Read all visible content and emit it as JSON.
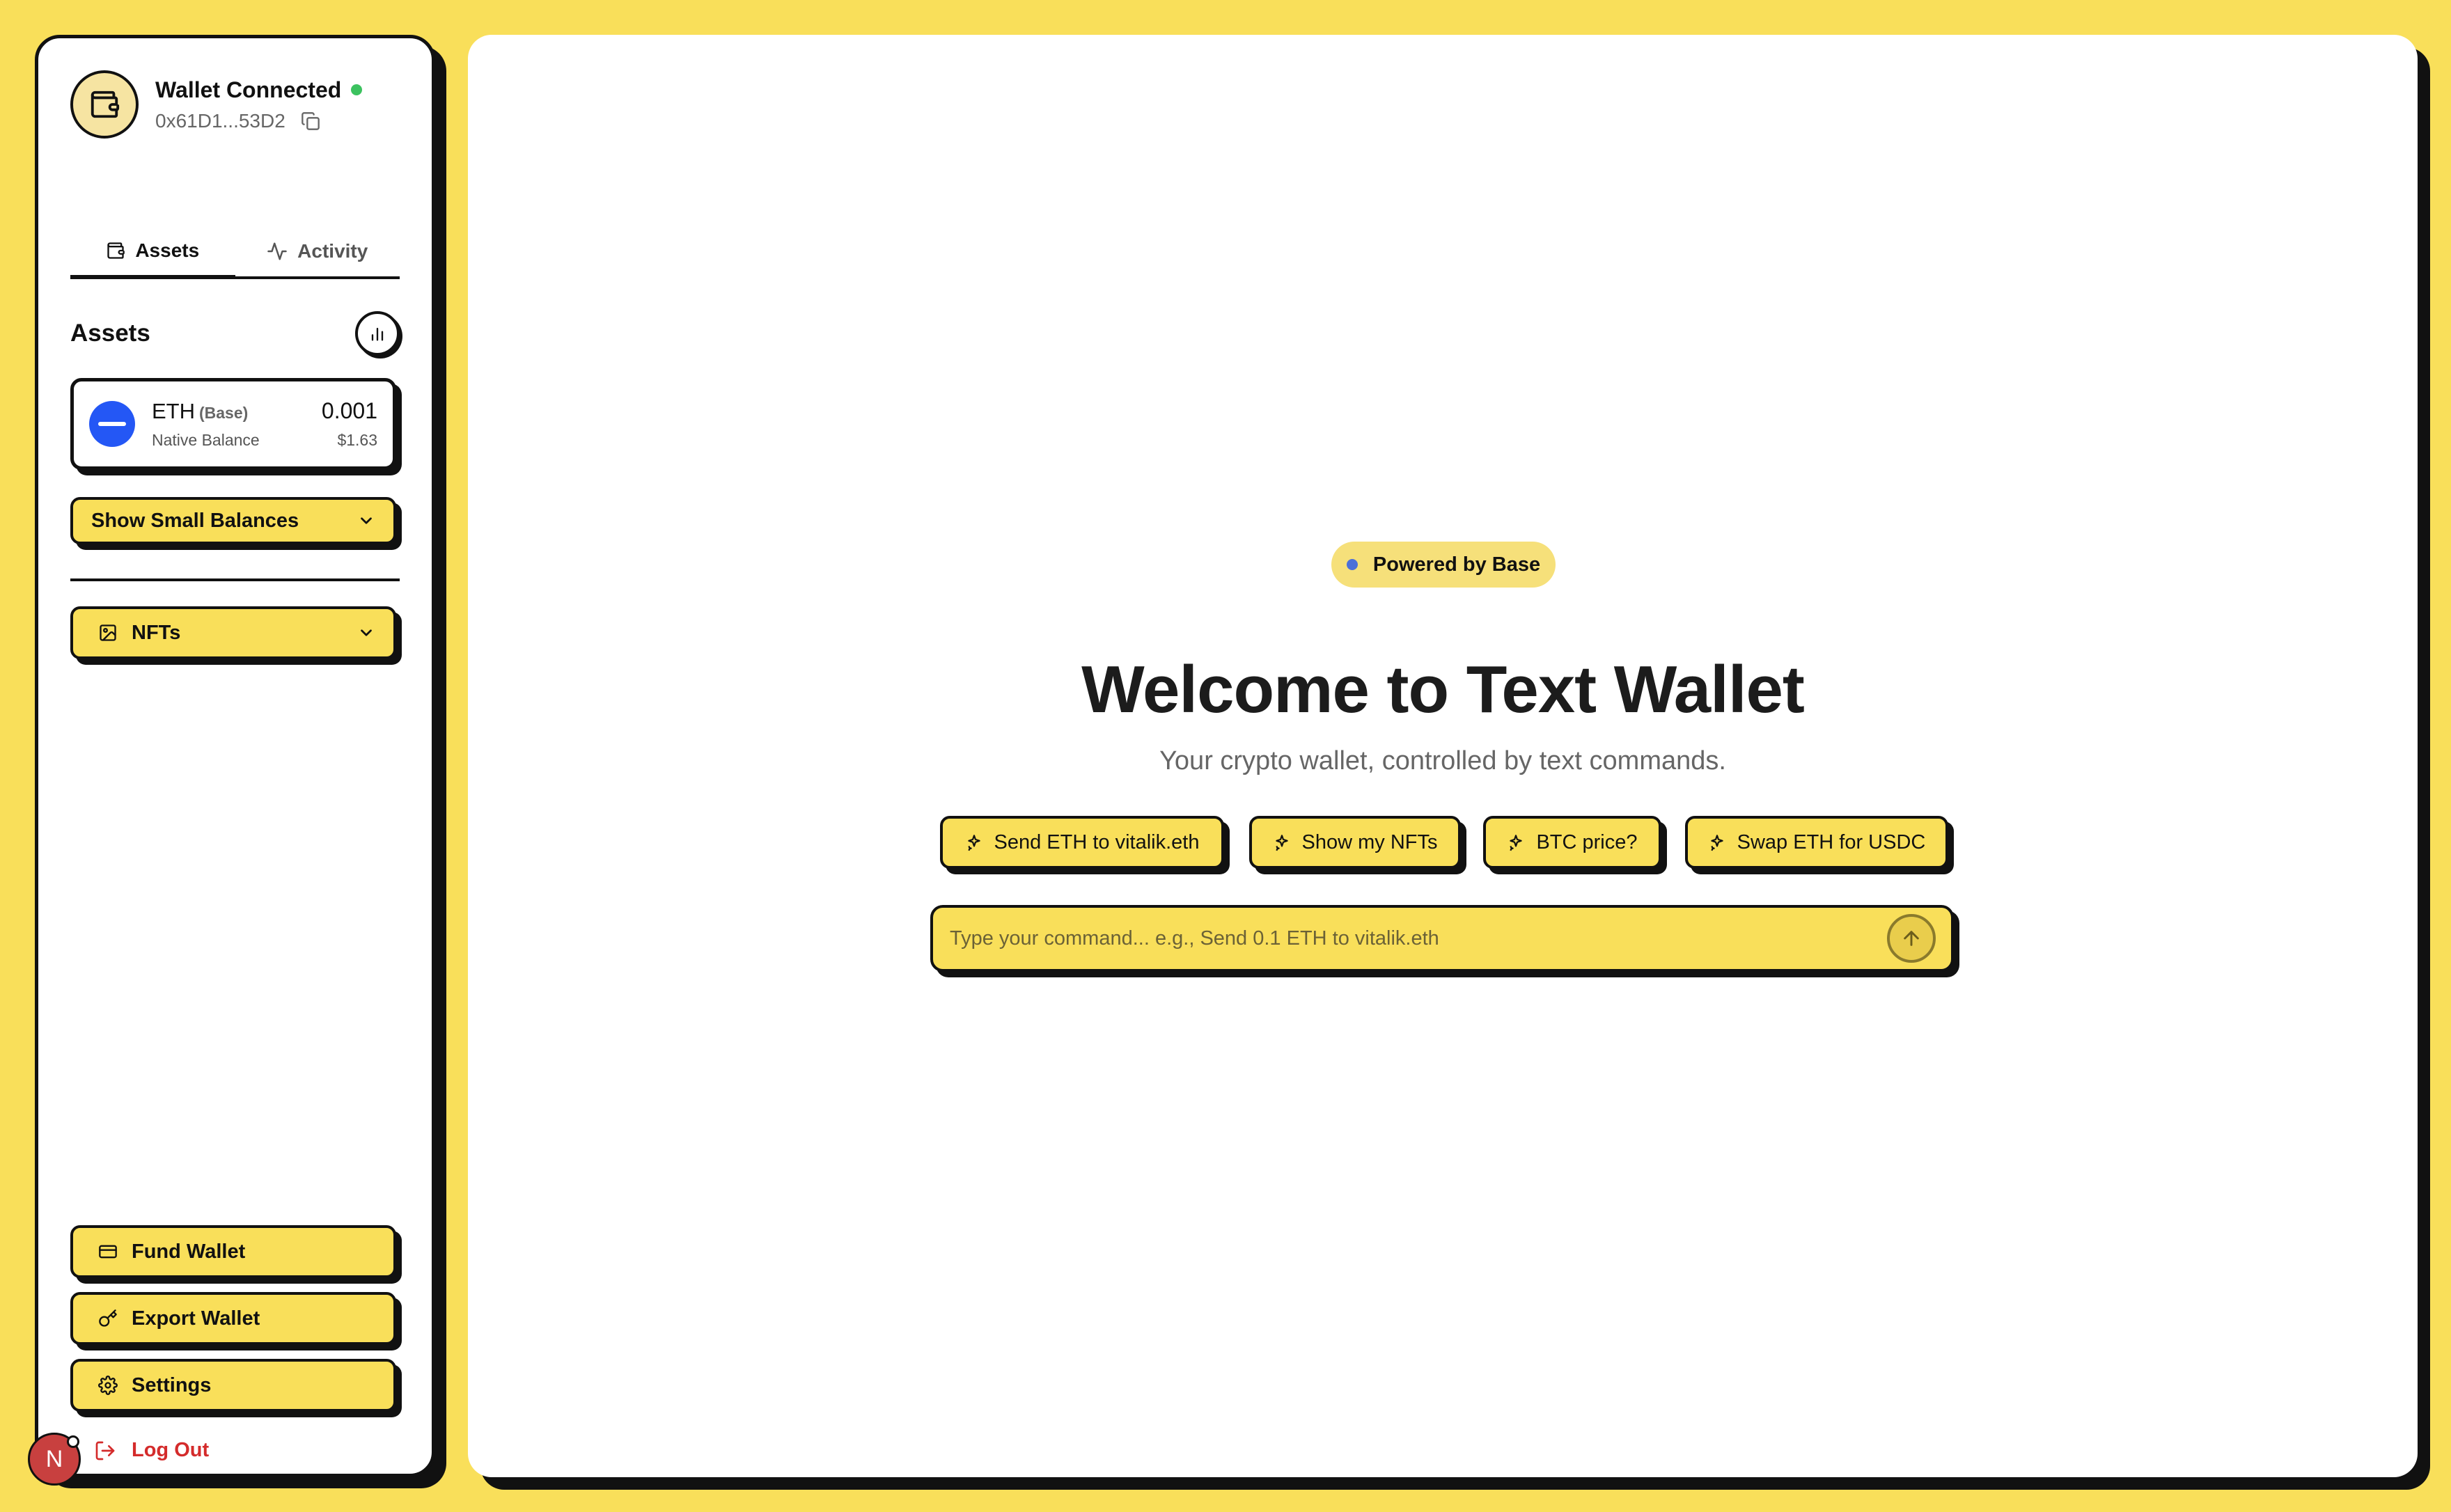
{
  "sidebar": {
    "wallet_title": "Wallet Connected",
    "wallet_address": "0x61D1...53D2",
    "tabs": [
      {
        "label": "Assets",
        "icon": "wallet-icon",
        "active": true
      },
      {
        "label": "Activity",
        "icon": "activity-icon",
        "active": false
      }
    ],
    "assets_heading": "Assets",
    "asset": {
      "symbol": "ETH",
      "chain": "(Base)",
      "subtitle": "Native Balance",
      "amount": "0.001",
      "usd": "$1.63"
    },
    "show_small_balances": "Show Small Balances",
    "nfts": "NFTs",
    "fund_wallet": "Fund Wallet",
    "export_wallet": "Export Wallet",
    "settings": "Settings",
    "log_out": "Log Out"
  },
  "dev_badge": "N",
  "main": {
    "powered_by": "Powered by Base",
    "welcome": "Welcome to Text Wallet",
    "subtitle": "Your crypto wallet, controlled by text commands.",
    "suggestions": [
      "Send ETH to vitalik.eth",
      "Show my NFTs",
      "BTC price?",
      "Swap ETH for USDC"
    ],
    "command_placeholder": "Type your command... e.g., Send 0.1 ETH to vitalik.eth"
  },
  "colors": {
    "background": "#f9df5a",
    "accent_yellow": "#f9df5a",
    "online": "#3cc25f",
    "eth_blue": "#2457f5",
    "logout_red": "#d42b2b"
  }
}
